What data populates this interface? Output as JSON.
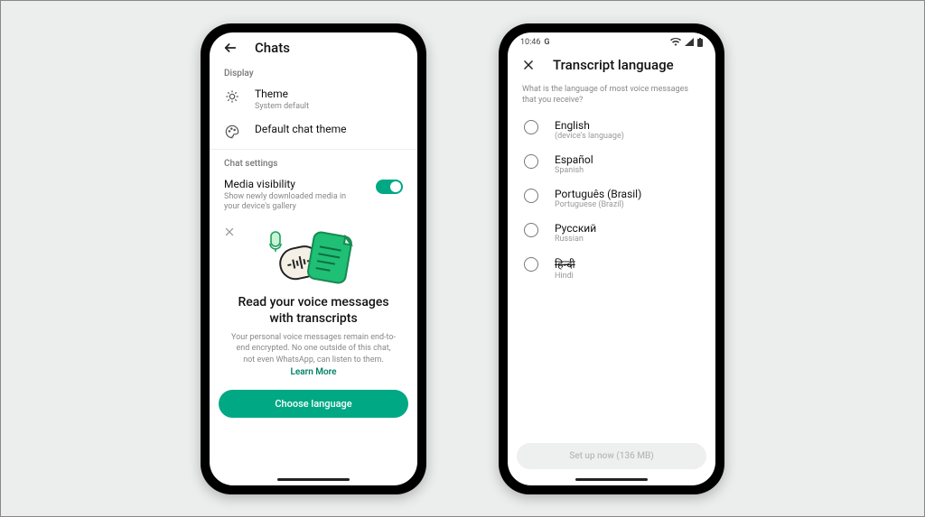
{
  "phone1": {
    "header": {
      "title": "Chats"
    },
    "display_section": {
      "label": "Display",
      "theme_title": "Theme",
      "theme_sub": "System default",
      "default_chat_theme": "Default chat theme"
    },
    "chat_settings_section": {
      "label": "Chat settings",
      "media_title": "Media visibility",
      "media_sub": "Show newly downloaded media in your device's gallery"
    },
    "promo": {
      "title": "Read your voice messages with transcripts",
      "body": "Your personal voice messages remain end-to-end encrypted. No one outside of this chat, not even WhatsApp, can listen to them.",
      "learn_more": "Learn More",
      "cta": "Choose language"
    }
  },
  "phone2": {
    "status_time": "10:46",
    "header": {
      "title": "Transcript language"
    },
    "question": "What is the language of most voice messages that you receive?",
    "languages": [
      {
        "name": "English",
        "sub": "(device's language)"
      },
      {
        "name": "Español",
        "sub": "Spanish"
      },
      {
        "name": "Português (Brasil)",
        "sub": "Portuguese (Brazil)"
      },
      {
        "name": "Русский",
        "sub": "Russian"
      },
      {
        "name": "हिन्दी",
        "sub": "Hindi"
      }
    ],
    "setup_label": "Set up now (136 MB)"
  }
}
